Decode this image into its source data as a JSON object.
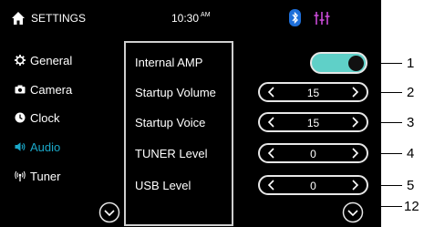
{
  "status_bar": {
    "title": "SETTINGS",
    "time": "10:30",
    "ampm": "AM",
    "icons": [
      "home-icon",
      "bluetooth-icon",
      "equalizer-icon"
    ]
  },
  "sidebar": {
    "items": [
      {
        "label": "General",
        "icon": "gear-icon",
        "active": false
      },
      {
        "label": "Camera",
        "icon": "camera-icon",
        "active": false
      },
      {
        "label": "Clock",
        "icon": "clock-icon",
        "active": false
      },
      {
        "label": "Audio",
        "icon": "speaker-icon",
        "active": true
      },
      {
        "label": "Tuner",
        "icon": "antenna-icon",
        "active": false
      }
    ]
  },
  "settings": {
    "internal_amp": {
      "label": "Internal AMP",
      "on": true
    },
    "startup_volume": {
      "label": "Startup Volume",
      "value": "15"
    },
    "startup_voice": {
      "label": "Startup Voice",
      "value": "15"
    },
    "tuner_level": {
      "label": "TUNER Level",
      "value": "0"
    },
    "usb_level": {
      "label": "USB Level",
      "value": "0"
    }
  },
  "callouts": [
    "1",
    "2",
    "3",
    "4",
    "5",
    "12"
  ],
  "colors": {
    "accent": "#1aa8c9",
    "toggle_on": "#5fd0c8",
    "background": "#000000"
  }
}
